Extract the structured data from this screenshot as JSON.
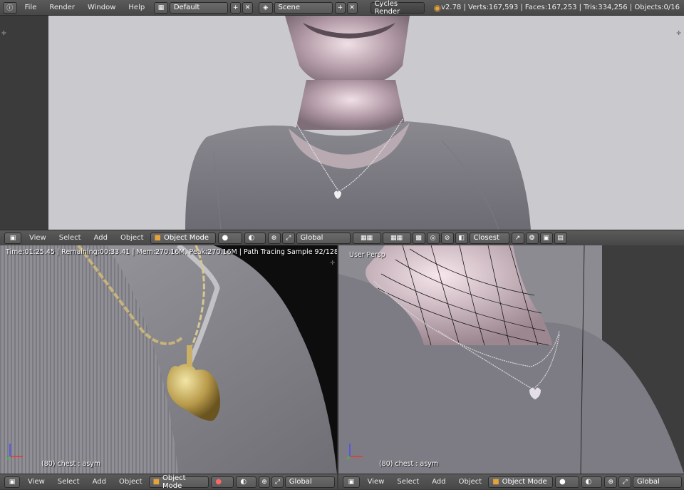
{
  "top_menu": {
    "items": [
      "File",
      "Render",
      "Window",
      "Help"
    ],
    "screen_layout": "Default",
    "scene": "Scene",
    "render_engine": "Cycles Render",
    "stats": "v2.78 | Verts:167,593 | Faces:167,253 | Tris:334,256 | Objects:0/16"
  },
  "view_header": {
    "view": "View",
    "select": "Select",
    "add": "Add",
    "object": "Object",
    "mode": "Object Mode",
    "orientation": "Global",
    "snap_target": "Closest"
  },
  "render_view": {
    "status": "Time:01:25.45 | Remaining:00:33.41 | Mem:270.16M, Peak:270.16M | Path Tracing Sample 92/128",
    "object_label": "(80) chest : asym"
  },
  "persp_view": {
    "view_name": "User Persp",
    "object_label": "(80) chest : asym"
  },
  "colors": {
    "header": "#4a4a4a",
    "viewport_bg": "#c9c8cd",
    "orange_accent": "#e8a23a"
  }
}
